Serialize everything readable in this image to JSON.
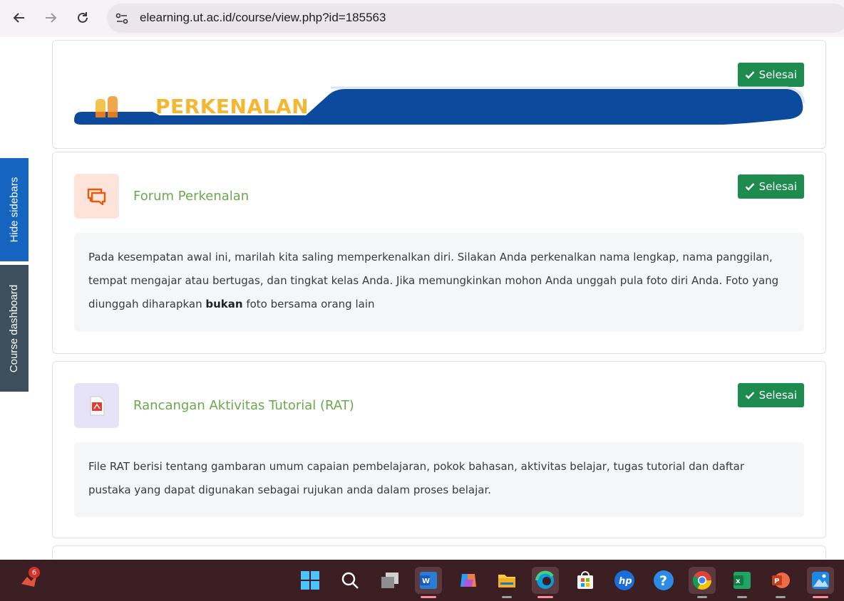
{
  "browser": {
    "url": "elearning.ut.ac.id/course/view.php?id=185563"
  },
  "sidebar_tabs": {
    "hide_sidebars": "Hide sidebars",
    "course_dashboard": "Course dashboard"
  },
  "section_banner": {
    "title": "PERKENALAN",
    "status": "Selesai",
    "colors": {
      "banner": "#0b4a9c",
      "title": "#f4b731"
    }
  },
  "activities": [
    {
      "title": "Forum Perkenalan",
      "icon": "forum-icon",
      "status": "Selesai",
      "description_parts": [
        "Pada kesempatan awal ini, marilah kita saling memperkenalkan diri. Silakan Anda perkenalkan nama lengkap, nama panggilan, tempat mengajar atau bertugas, dan tingkat kelas Anda. Jika memungkinkan mohon Anda unggah pula foto diri Anda. Foto yang diunggah diharapkan ",
        "bukan",
        " foto bersama orang lain"
      ]
    },
    {
      "title": "Rancangan Aktivitas Tutorial (RAT)",
      "icon": "pdf-icon",
      "status": "Selesai",
      "description": "File RAT berisi tentang gambaran umum capaian pembelajaran, pokok bahasan, aktivitas belajar, tugas tutorial dan daftar pustaka yang dapat digunakan sebagai rujukan anda dalam proses belajar."
    }
  ],
  "taskbar": {
    "notification_badge": "6",
    "apps": [
      "start-icon",
      "search-icon",
      "task-view-icon",
      "word-icon",
      "copilot-icon",
      "file-explorer-icon",
      "edge-icon",
      "store-icon",
      "hp-icon",
      "help-icon",
      "chrome-icon",
      "excel-icon",
      "powerpoint-icon",
      "photos-icon"
    ]
  },
  "colors": {
    "success": "#1d8a4e",
    "activity_title": "#6aa84f",
    "hide_sidebars_tab": "#1565c0",
    "course_dashboard_tab": "#3d4f5c"
  }
}
